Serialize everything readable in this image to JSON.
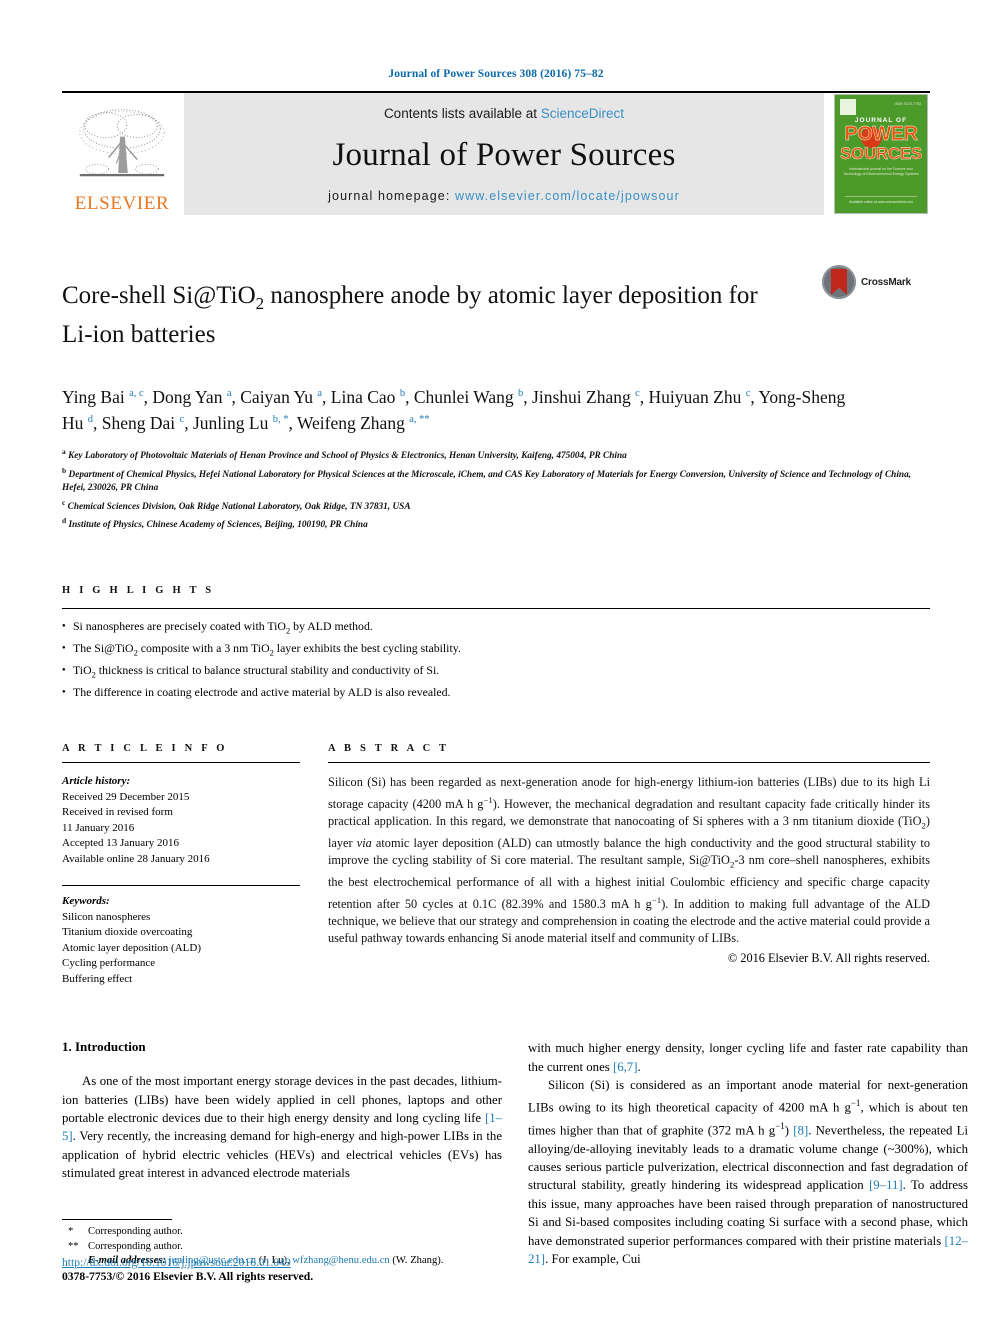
{
  "running_head": "Journal of Power Sources 308 (2016) 75–82",
  "masthead": {
    "publisher": "ELSEVIER",
    "contents_prefix": "Contents lists available at ",
    "contents_link": "ScienceDirect",
    "journal_name": "Journal of Power Sources",
    "homepage_prefix": "journal homepage: ",
    "homepage_url": "www.elsevier.com/locate/jpowsour",
    "cover": {
      "line1": "JOURNAL OF",
      "line2": "POWER",
      "line3": "SOURCES",
      "blurb": "International journal on the Science and Technology of Electrochemical Energy Systems",
      "footer": "Available online at www.sciencedirect.com"
    },
    "colors": {
      "link_blue": "#3a8fc4",
      "running_head_blue": "#0b6aa8",
      "elsevier_orange": "#E87722",
      "cover_green": "#4c9a2a",
      "cover_orange": "#E8540C"
    }
  },
  "title": {
    "line1_a": "Core-shell Si@TiO",
    "line1_sub": "2",
    "line1_b": " nanosphere anode by atomic layer deposition for",
    "line2": "Li-ion batteries",
    "crossmark_label": "CrossMark"
  },
  "authors": {
    "list": [
      {
        "name": "Ying Bai",
        "marks": "a, c"
      },
      {
        "name": "Dong Yan",
        "marks": "a"
      },
      {
        "name": "Caiyan Yu",
        "marks": "a"
      },
      {
        "name": "Lina Cao",
        "marks": "b"
      },
      {
        "name": "Chunlei Wang",
        "marks": "b"
      },
      {
        "name": "Jinshui Zhang",
        "marks": "c"
      },
      {
        "name": "Huiyuan Zhu",
        "marks": "c"
      },
      {
        "name": "Yong-Sheng Hu",
        "marks": "d"
      },
      {
        "name": "Sheng Dai",
        "marks": "c"
      },
      {
        "name": "Junling Lu",
        "marks": "b, *"
      },
      {
        "name": "Weifeng Zhang",
        "marks": "a, **"
      }
    ]
  },
  "affiliations": [
    {
      "mark": "a",
      "text": "Key Laboratory of Photovoltaic Materials of Henan Province and School of Physics & Electronics, Henan University, Kaifeng, 475004, PR China"
    },
    {
      "mark": "b",
      "text": "Department of Chemical Physics, Hefei National Laboratory for Physical Sciences at the Microscale, iChem, and CAS Key Laboratory of Materials for Energy Conversion, University of Science and Technology of China, Hefei, 230026, PR China"
    },
    {
      "mark": "c",
      "text": "Chemical Sciences Division, Oak Ridge National Laboratory, Oak Ridge, TN 37831, USA"
    },
    {
      "mark": "d",
      "text": "Institute of Physics, Chinese Academy of Sciences, Beijing, 100190, PR China"
    }
  ],
  "highlights": {
    "heading": "H I G H L I G H T S",
    "items": [
      {
        "pre": "Si nanospheres are precisely coated with TiO",
        "sub": "2",
        "post": " by ALD method."
      },
      {
        "pre": "The Si@TiO",
        "sub": "2",
        "post": " composite with a 3 nm TiO₂ layer exhibits the best cycling stability."
      },
      {
        "pre": "TiO",
        "sub": "2",
        "post": " thickness is critical to balance structural stability and conductivity of Si."
      },
      {
        "pre": "The difference in coating electrode and active material by ALD is also revealed.",
        "sub": "",
        "post": ""
      }
    ]
  },
  "article_info": {
    "heading": "A R T I C L E  I N F O",
    "history_label": "Article history:",
    "history_lines": [
      "Received 29 December 2015",
      "Received in revised form",
      "11 January 2016",
      "Accepted 13 January 2016",
      "Available online 28 January 2016"
    ],
    "keywords_label": "Keywords:",
    "keywords": [
      "Silicon nanospheres",
      "Titanium dioxide overcoating",
      "Atomic layer deposition (ALD)",
      "Cycling performance",
      "Buffering effect"
    ]
  },
  "abstract": {
    "heading": "A B S T R A C T",
    "text_parts": [
      "Silicon (Si) has been regarded as next-generation anode for high-energy lithium-ion batteries (LIBs) due to its high Li storage capacity (4200 mA h g",
      "−1",
      "). However, the mechanical degradation and resultant capacity fade critically hinder its practical application. In this regard, we demonstrate that nanocoating of Si spheres with a 3 nm titanium dioxide (TiO",
      "2",
      ") layer ",
      "via",
      " atomic layer deposition (ALD) can utmostly balance the high conductivity and the good structural stability to improve the cycling stability of Si core material. The resultant sample, Si@TiO",
      "2",
      "-3 nm core–shell nanospheres, exhibits the best electrochemical performance of all with a highest initial Coulombic efficiency and specific charge capacity retention after 50 cycles at 0.1C (82.39% and 1580.3 mA h g",
      "−1",
      "). In addition to making full advantage of the ALD technique, we believe that our strategy and comprehension in coating the electrode and the active material could provide a useful pathway towards enhancing Si anode material itself and community of LIBs."
    ],
    "copyright": "© 2016 Elsevier B.V. All rights reserved."
  },
  "body": {
    "section_title": "1. Introduction",
    "left_para_parts": [
      "As one of the most important energy storage devices in the past decades, lithium-ion batteries (LIBs) have been widely applied in cell phones, laptops and other portable electronic devices due to their high energy density and long cycling life ",
      "[1–5]",
      ". Very recently, the increasing demand for high-energy and high-power LIBs in the application of hybrid electric vehicles (HEVs) and electrical vehicles (EVs) has stimulated great interest in advanced electrode materials"
    ],
    "right_cont_parts": [
      "with much higher energy density, longer cycling life and faster rate capability than the current ones ",
      "[6,7]",
      "."
    ],
    "right_para_parts": [
      "Silicon (Si) is considered as an important anode material for next-generation LIBs owing to its high theoretical capacity of 4200 mA h g",
      "−1",
      ", which is about ten times higher than that of graphite (372 mA h g",
      "−1",
      ") ",
      "[8]",
      ". Nevertheless, the repeated Li alloying/de-alloying inevitably leads to a dramatic volume change (~300%), which causes serious particle pulverization, electrical disconnection and fast degradation of structural stability, greatly hindering its widespread application ",
      "[9–11]",
      ". To address this issue, many approaches have been raised through preparation of nanostructured Si and Si-based composites including coating Si surface with a second phase, which have demonstrated superior performances compared with their pristine materials ",
      "[12–21]",
      ". For example, Cui"
    ]
  },
  "footnotes": {
    "corr1_mark": "*",
    "corr1_text": "Corresponding author.",
    "corr2_mark": "**",
    "corr2_text": "Corresponding author.",
    "email_label": "E-mail addresses:",
    "email1": "junling@ustc.edu.cn",
    "email1_who": "(J. Lu)",
    "email2": "wfzhang@henu.edu.cn",
    "email2_who": "(W. Zhang)."
  },
  "doi": {
    "url": "http://dx.doi.org/10.1016/j.jpowsour.2016.01.049",
    "issn_line": "0378-7753/© 2016 Elsevier B.V. All rights reserved."
  }
}
